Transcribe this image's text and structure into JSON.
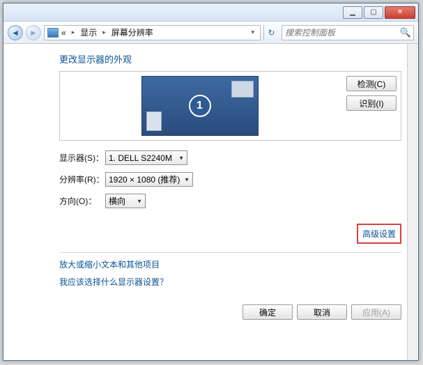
{
  "titlebar": {
    "min_glyph": "▁",
    "max_glyph": "▢",
    "close_glyph": "✕"
  },
  "nav": {
    "back_glyph": "◄",
    "fwd_glyph": "►",
    "addr_sep": "▸",
    "refresh_glyph": "↻",
    "search_glyph": "🔍"
  },
  "breadcrumbs": {
    "root": "«",
    "d1": "显示",
    "d2": "屏幕分辨率"
  },
  "search": {
    "placeholder": "搜索控制面板"
  },
  "page": {
    "title": "更改显示器的外观"
  },
  "monitor": {
    "number": "1"
  },
  "side_buttons": {
    "detect": "检测(C)",
    "identify": "识别(I)"
  },
  "form": {
    "display_label": "显示器(S)：",
    "display_value": "1. DELL S2240M",
    "resolution_label": "分辨率(R)：",
    "resolution_value": "1920 × 1080 (推荐)",
    "orientation_label": "方向(O)：",
    "orientation_value": "横向",
    "dd_arrow": "▼"
  },
  "advanced_link": "高级设置",
  "links": {
    "textsize": "放大或缩小文本和其他项目",
    "whichdisplay": "我应该选择什么显示器设置？"
  },
  "footer": {
    "ok": "确定",
    "cancel": "取消",
    "apply": "应用(A)"
  }
}
